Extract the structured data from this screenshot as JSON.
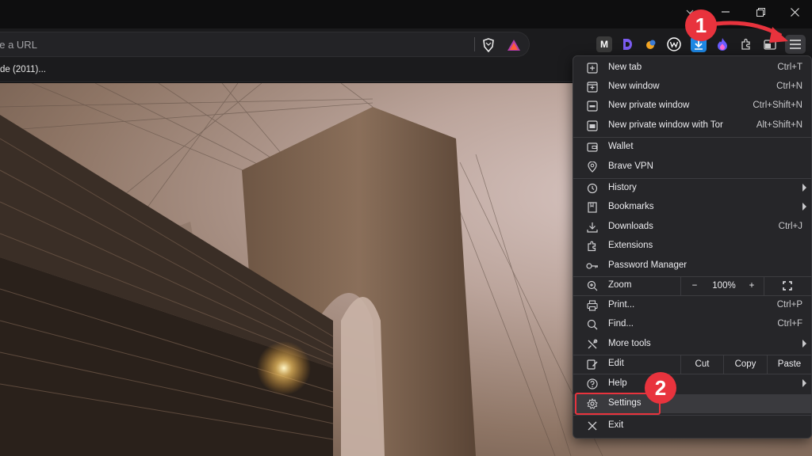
{
  "omnibox": {
    "text": "pe a URL"
  },
  "bookmark_bar": {
    "item": "de (2011)..."
  },
  "menu": {
    "new_tab": {
      "label": "New tab",
      "shortcut": "Ctrl+T"
    },
    "new_window": {
      "label": "New window",
      "shortcut": "Ctrl+N"
    },
    "new_private": {
      "label": "New private window",
      "shortcut": "Ctrl+Shift+N"
    },
    "new_private_tor": {
      "label": "New private window with Tor",
      "shortcut": "Alt+Shift+N"
    },
    "wallet": {
      "label": "Wallet"
    },
    "vpn": {
      "label": "Brave VPN"
    },
    "history": {
      "label": "History"
    },
    "bookmarks": {
      "label": "Bookmarks"
    },
    "downloads": {
      "label": "Downloads",
      "shortcut": "Ctrl+J"
    },
    "extensions": {
      "label": "Extensions"
    },
    "passwords": {
      "label": "Password Manager"
    },
    "zoom": {
      "label": "Zoom",
      "minus": "−",
      "value": "100%",
      "plus": "+"
    },
    "print": {
      "label": "Print...",
      "shortcut": "Ctrl+P"
    },
    "find": {
      "label": "Find...",
      "shortcut": "Ctrl+F"
    },
    "more_tools": {
      "label": "More tools"
    },
    "edit": {
      "label": "Edit",
      "cut": "Cut",
      "copy": "Copy",
      "paste": "Paste"
    },
    "help": {
      "label": "Help"
    },
    "settings": {
      "label": "Settings"
    },
    "exit": {
      "label": "Exit"
    }
  },
  "annotations": {
    "step1": "1",
    "step2": "2",
    "color": "#e8333d"
  },
  "extensions": [
    {
      "name": "m-extension-icon",
      "glyph": "M",
      "color": "#3a3a3a"
    },
    {
      "name": "d-extension-icon",
      "glyph": "D",
      "color": "#7b5cf0"
    },
    {
      "name": "honey-extension-icon",
      "glyph": "",
      "color": "#f5a623"
    },
    {
      "name": "w-extension-icon",
      "glyph": "W",
      "color": "#ffffff"
    },
    {
      "name": "download-extension-icon",
      "glyph": "",
      "color": "#1e88e5"
    },
    {
      "name": "flame-extension-icon",
      "glyph": "",
      "color": "#7c4dff"
    }
  ]
}
